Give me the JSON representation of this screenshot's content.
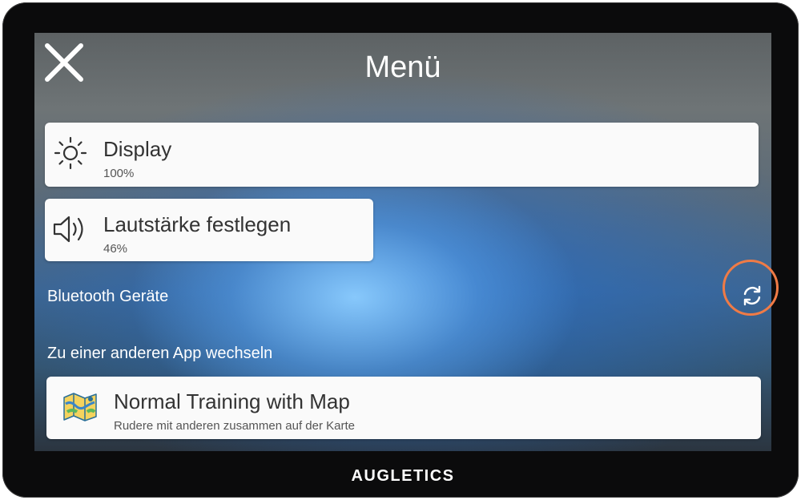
{
  "header": {
    "title": "Menü"
  },
  "settings": [
    {
      "label": "Display",
      "value": "100%",
      "icon": "sun-icon"
    },
    {
      "label": "Lautstärke festlegen",
      "value": "46%",
      "icon": "speaker-icon"
    }
  ],
  "bluetooth": {
    "label": "Bluetooth Geräte",
    "refresh_icon": "refresh-icon"
  },
  "apps": {
    "label": "Zu einer anderen App wechseln",
    "items": [
      {
        "title": "Normal Training with Map",
        "subtitle": "Rudere mit anderen zusammen auf der Karte",
        "icon": "map-icon"
      }
    ]
  },
  "brand": "AUGLETICS",
  "colors": {
    "highlight": "#f07b46",
    "card": "#fafafa"
  }
}
